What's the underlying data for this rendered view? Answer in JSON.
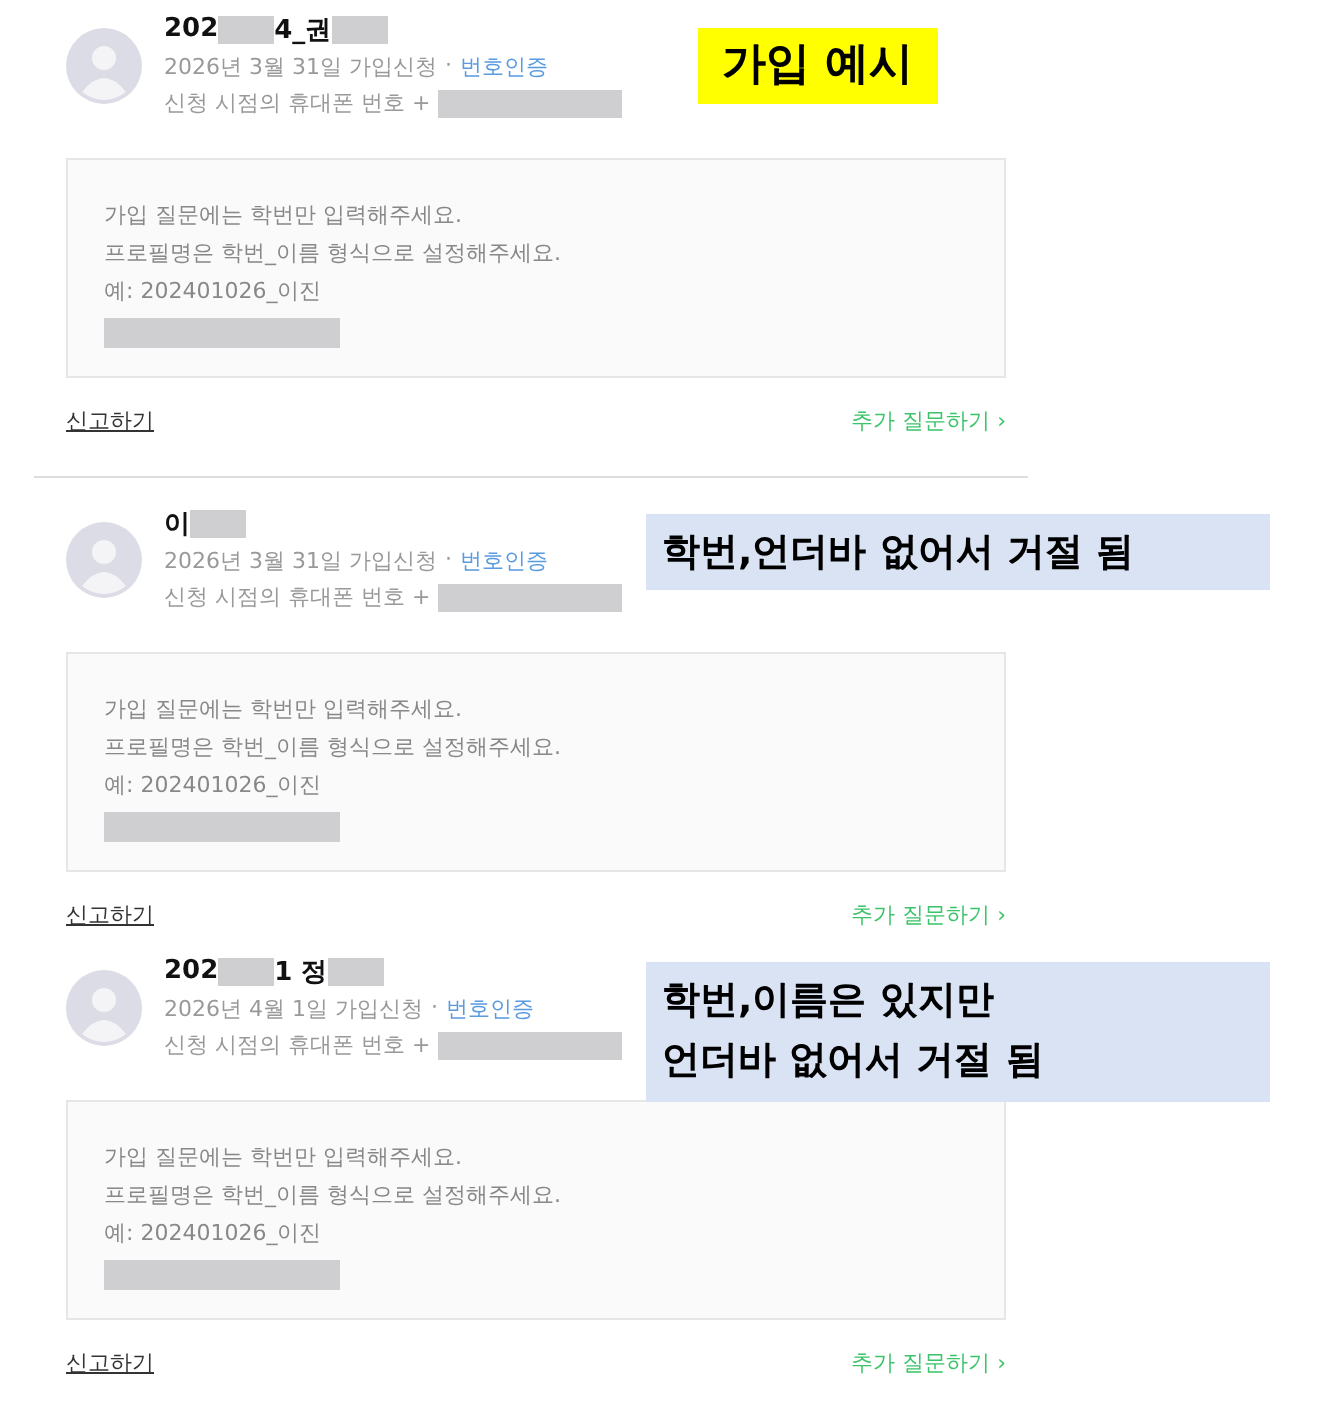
{
  "entries": [
    {
      "name_parts": [
        {
          "kind": "text",
          "text": "202"
        },
        {
          "kind": "redacted"
        },
        {
          "kind": "text",
          "text": "4_권"
        },
        {
          "kind": "redacted"
        }
      ],
      "date": "2026년 3월 31일 가입신청",
      "separator": "·",
      "verify": "번호인증",
      "phone_label": "신청 시점의 휴대폰 번호 +",
      "answer_lines": [
        "가입 질문에는 학번만 입력해주세요.",
        "프로필명은 학번_이름 형식으로 설정해주세요.",
        "예: 202401026_이진"
      ],
      "report": "신고하기",
      "more": "추가 질문하기 ›",
      "divider_after": true,
      "callout": {
        "lines": [
          "가입 예시"
        ],
        "color": "#ffff00"
      }
    },
    {
      "name_parts": [
        {
          "kind": "text",
          "text": "이"
        },
        {
          "kind": "redacted"
        }
      ],
      "date": "2026년 3월 31일 가입신청",
      "separator": "·",
      "verify": "번호인증",
      "phone_label": "신청 시점의 휴대폰 번호 +",
      "answer_lines": [
        "가입 질문에는 학번만 입력해주세요.",
        "프로필명은 학번_이름 형식으로 설정해주세요.",
        "예: 202401026_이진"
      ],
      "report": "신고하기",
      "more": "추가 질문하기 ›",
      "divider_after": false,
      "callout": {
        "lines": [
          "학번,언더바 없어서 거절 됨"
        ],
        "color": "#dae3f3"
      }
    },
    {
      "name_parts": [
        {
          "kind": "text",
          "text": "202"
        },
        {
          "kind": "redacted"
        },
        {
          "kind": "text",
          "text": "1 정"
        },
        {
          "kind": "redacted"
        }
      ],
      "date": "2026년 4월 1일 가입신청",
      "separator": "·",
      "verify": "번호인증",
      "phone_label": "신청 시점의 휴대폰 번호 +",
      "answer_lines": [
        "가입 질문에는 학번만 입력해주세요.",
        "프로필명은 학번_이름 형식으로 설정해주세요.",
        "예: 202401026_이진"
      ],
      "report": "신고하기",
      "more": "추가 질문하기 ›",
      "divider_after": false,
      "callout": {
        "lines": [
          "학번,이름은 있지만",
          "언더바 없어서 거절 됨"
        ],
        "color": "#dae3f3"
      }
    }
  ]
}
